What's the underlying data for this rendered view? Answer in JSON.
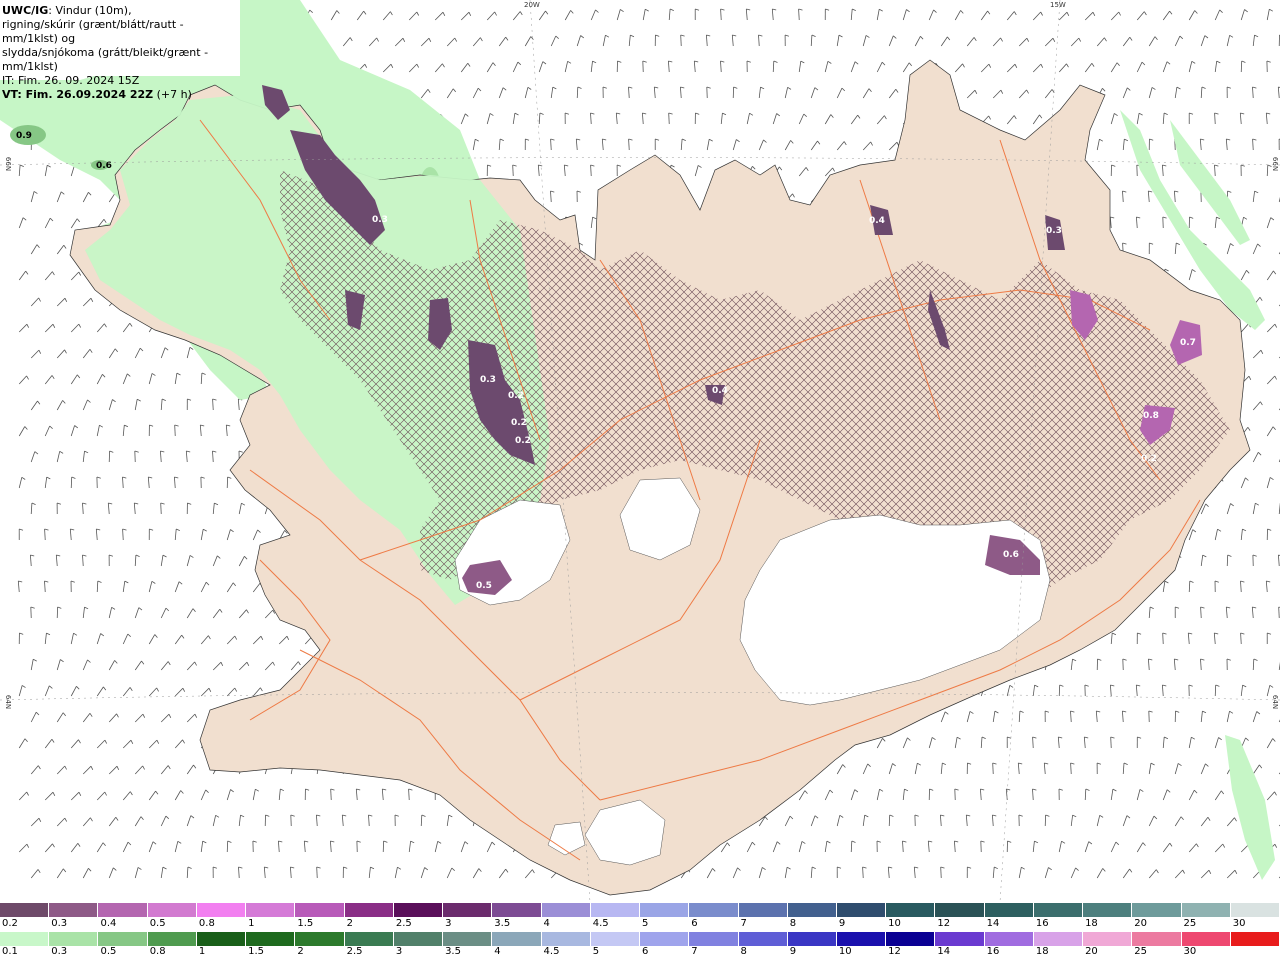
{
  "header": {
    "model": "UWC/IG",
    "desc_line1": ": Vindur (10m),",
    "desc_line2": "rigning/skúrir (grænt/blátt/rautt - mm/1klst) og",
    "desc_line3": "slydda/snjókoma (grátt/bleikt/grænt - mm/1klst)",
    "issue_time": "IT: Fim. 26. 09. 2024 15Z",
    "valid_time": "VT: Fim. 26.09.2024 22Z",
    "lead": "(+7 h)"
  },
  "gridlabels": {
    "lon_20w": "20W",
    "lon_15w": "15W",
    "lat_66n_left": "66N",
    "lat_66n_right": "66N",
    "lat_64n_left": "64N",
    "lat_64n_right": "64N"
  },
  "sleet_snow_scale": {
    "labels": [
      "0.2",
      "0.3",
      "0.4",
      "0.5",
      "0.8",
      "1",
      "1.5",
      "2",
      "2.5",
      "3",
      "3.5",
      "4",
      "4.5",
      "5",
      "6",
      "7",
      "8",
      "9",
      "10",
      "12",
      "14",
      "16",
      "18",
      "20",
      "25",
      "30"
    ],
    "colors": [
      "#6e4a69",
      "#8e5a87",
      "#b466b0",
      "#d27ad0",
      "#f27ff0",
      "#d57ad7",
      "#b85ab9",
      "#8a2e86",
      "#5a0f5a",
      "#6b2b6d",
      "#7d4b94",
      "#9b8ed6",
      "#b7b7f2",
      "#9aa5e6",
      "#7a8ccc",
      "#5c72ae",
      "#42608e",
      "#2f4d6e",
      "#295a60",
      "#2a5256",
      "#2d5f60",
      "#3b6e6d",
      "#4d7f7e",
      "#6e9b9b",
      "#8fb2b1",
      "#d9e2e1"
    ]
  },
  "rain_scale": {
    "labels": [
      "0.1",
      "0.3",
      "0.5",
      "0.8",
      "1",
      "1.5",
      "2",
      "2.5",
      "3",
      "3.5",
      "4",
      "4.5",
      "5",
      "6",
      "7",
      "8",
      "9",
      "10",
      "12",
      "14",
      "16",
      "18",
      "20",
      "25",
      "30"
    ],
    "colors": [
      "#c8f7c9",
      "#a9e3a7",
      "#86c785",
      "#4f9b4f",
      "#195f19",
      "#1e6a1e",
      "#2c7a2c",
      "#3a7b52",
      "#51806a",
      "#6b8e85",
      "#8ba7b9",
      "#a8b8e0",
      "#c4c8f4",
      "#9fa4ec",
      "#8081e0",
      "#5f5ed6",
      "#3a36c4",
      "#1a10ad",
      "#0a0093",
      "#6a3ad0",
      "#a06ce0",
      "#d8a2e8",
      "#f0a8d6",
      "#ec7aa0",
      "#ee4870",
      "#e81c1c"
    ]
  },
  "contour_labels": [
    {
      "text": "0.9"
    },
    {
      "text": "0.6"
    },
    {
      "text": "0.3"
    },
    {
      "text": "0.3"
    },
    {
      "text": "0.2"
    },
    {
      "text": "0.4"
    },
    {
      "text": "0.3"
    },
    {
      "text": "0.2"
    },
    {
      "text": "0.4"
    },
    {
      "text": "0.2"
    },
    {
      "text": "0.5"
    },
    {
      "text": "0.6"
    },
    {
      "text": "0.8"
    },
    {
      "text": "0.7"
    },
    {
      "text": "0.2"
    }
  ],
  "colors": {
    "land": "#f1dfcf",
    "ocean": "#ffffff",
    "glacier": "#ffffff",
    "rain_light": "#c6f6c6",
    "snow_dark": "#6c4a6e",
    "snow_bright": "#d25fd6",
    "roads": "#ee7a45",
    "wind_barb": "#555555"
  }
}
